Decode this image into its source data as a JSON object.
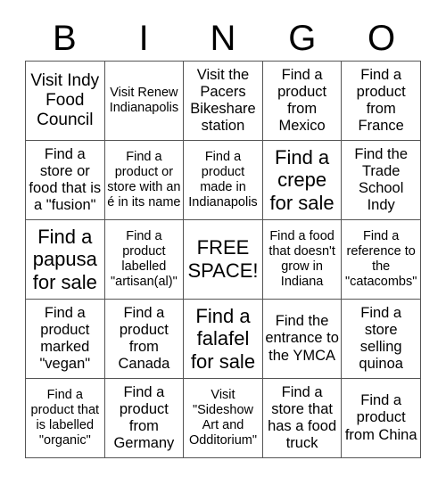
{
  "card": {
    "title_letters": [
      "B",
      "I",
      "N",
      "G",
      "O"
    ],
    "columns": 5,
    "rows": 5,
    "border_color": "#555555",
    "text_color": "#000000",
    "background_color": "#ffffff",
    "squares": [
      {
        "text": "Visit Indy Food Council",
        "size": "lg"
      },
      {
        "text": "Visit Renew Indianapolis",
        "size": "sm"
      },
      {
        "text": "Visit the Pacers Bikeshare station",
        "size": "md"
      },
      {
        "text": "Find a product from Mexico",
        "size": "md"
      },
      {
        "text": "Find a product from France",
        "size": "md"
      },
      {
        "text": "Find a store or food that is a \"fusion\"",
        "size": "md"
      },
      {
        "text": "Find a product or store with an é in its name",
        "size": "sm"
      },
      {
        "text": "Find a product made in Indianapolis",
        "size": "sm"
      },
      {
        "text": "Find a crepe for sale",
        "size": "xl"
      },
      {
        "text": "Find the Trade School Indy",
        "size": "md"
      },
      {
        "text": "Find a papusa for sale",
        "size": "xl"
      },
      {
        "text": "Find a product labelled \"artisan(al)\"",
        "size": "sm"
      },
      {
        "text": "FREE SPACE!",
        "size": "free"
      },
      {
        "text": "Find a food that doesn't grow in Indiana",
        "size": "sm"
      },
      {
        "text": "Find a reference to the \"catacombs\"",
        "size": "sm"
      },
      {
        "text": "Find a product marked \"vegan\"",
        "size": "md"
      },
      {
        "text": "Find a product from Canada",
        "size": "md"
      },
      {
        "text": "Find a falafel for sale",
        "size": "xl"
      },
      {
        "text": "Find the entrance to the YMCA",
        "size": "md"
      },
      {
        "text": "Find a store selling quinoa",
        "size": "md"
      },
      {
        "text": "Find a product that is labelled \"organic\"",
        "size": "sm"
      },
      {
        "text": "Find a product from Germany",
        "size": "md"
      },
      {
        "text": "Visit \"Sideshow Art and Odditorium\"",
        "size": "sm"
      },
      {
        "text": "Find a store that has a food truck",
        "size": "md"
      },
      {
        "text": "Find a product from China",
        "size": "md"
      }
    ]
  }
}
